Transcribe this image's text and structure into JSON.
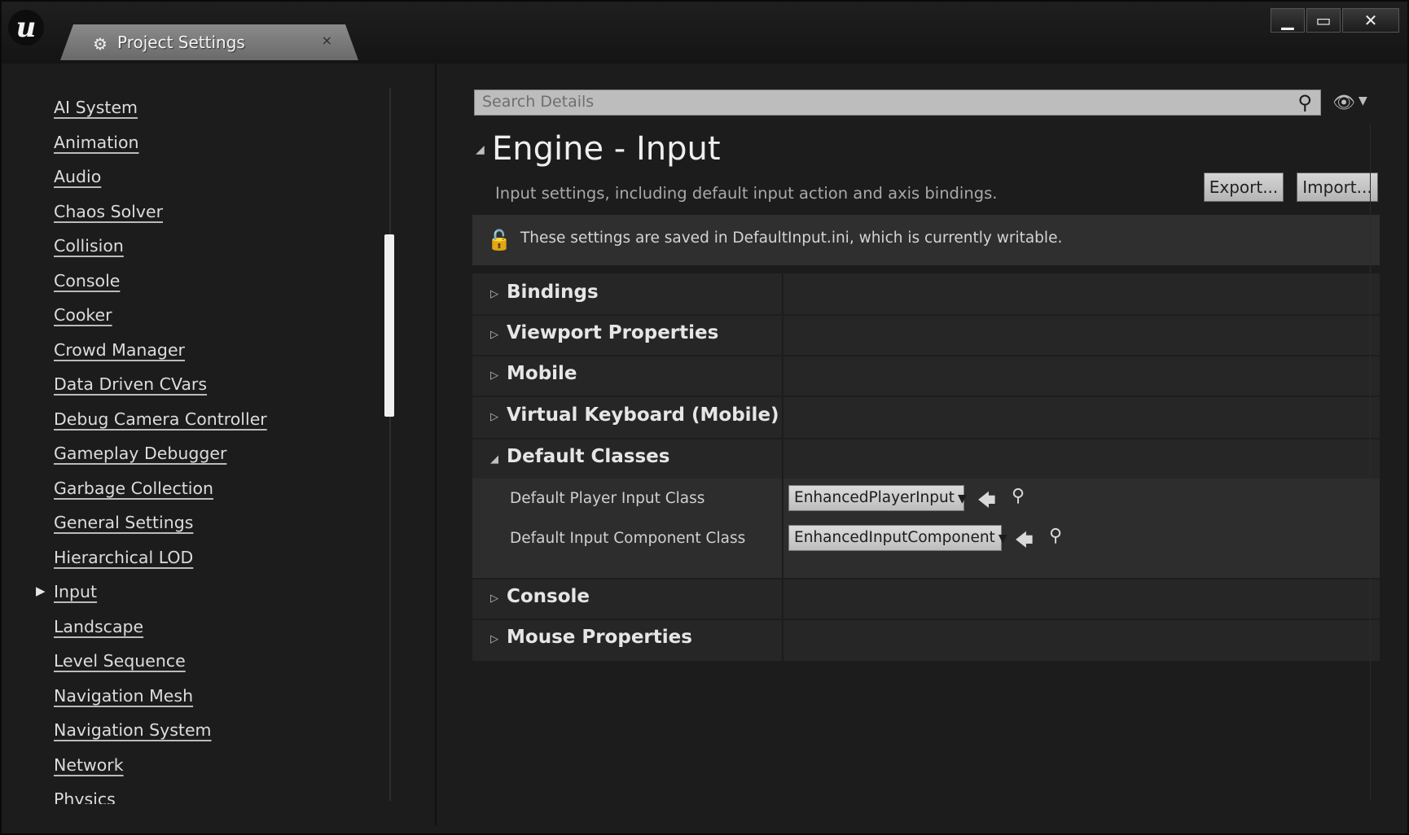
{
  "titlebar": {
    "tab_label": "Project Settings",
    "tab_close": "×",
    "minimize": "▁",
    "maximize": "▭",
    "close": "✕",
    "logo": "u"
  },
  "sidebar": {
    "items": [
      {
        "label": "AI System"
      },
      {
        "label": "Animation"
      },
      {
        "label": "Audio"
      },
      {
        "label": "Chaos Solver"
      },
      {
        "label": "Collision"
      },
      {
        "label": "Console"
      },
      {
        "label": "Cooker"
      },
      {
        "label": "Crowd Manager"
      },
      {
        "label": "Data Driven CVars"
      },
      {
        "label": "Debug Camera Controller"
      },
      {
        "label": "Gameplay Debugger"
      },
      {
        "label": "Garbage Collection"
      },
      {
        "label": "General Settings"
      },
      {
        "label": "Hierarchical LOD"
      },
      {
        "label": "Input"
      },
      {
        "label": "Landscape"
      },
      {
        "label": "Level Sequence"
      },
      {
        "label": "Navigation Mesh"
      },
      {
        "label": "Navigation System"
      },
      {
        "label": "Network"
      },
      {
        "label": "Physics"
      }
    ],
    "selected": "Input"
  },
  "details": {
    "search_placeholder": "Search Details",
    "title": "Engine - Input",
    "subtitle": "Input settings, including default input action and axis bindings.",
    "export_label": "Export...",
    "import_label": "Import...",
    "notice": "These settings are saved in DefaultInput.ini, which is currently writable.",
    "sections": [
      {
        "label": "Bindings",
        "expanded": false
      },
      {
        "label": "Viewport Properties",
        "expanded": false
      },
      {
        "label": "Mobile",
        "expanded": false
      },
      {
        "label": "Virtual Keyboard (Mobile)",
        "expanded": false
      },
      {
        "label": "Default Classes",
        "expanded": true
      },
      {
        "label": "Console",
        "expanded": false
      },
      {
        "label": "Mouse Properties",
        "expanded": false
      }
    ],
    "properties": [
      {
        "label": "Default Player Input Class",
        "value": "EnhancedPlayerInput"
      },
      {
        "label": "Default Input Component Class",
        "value": "EnhancedInputComponent"
      }
    ]
  }
}
